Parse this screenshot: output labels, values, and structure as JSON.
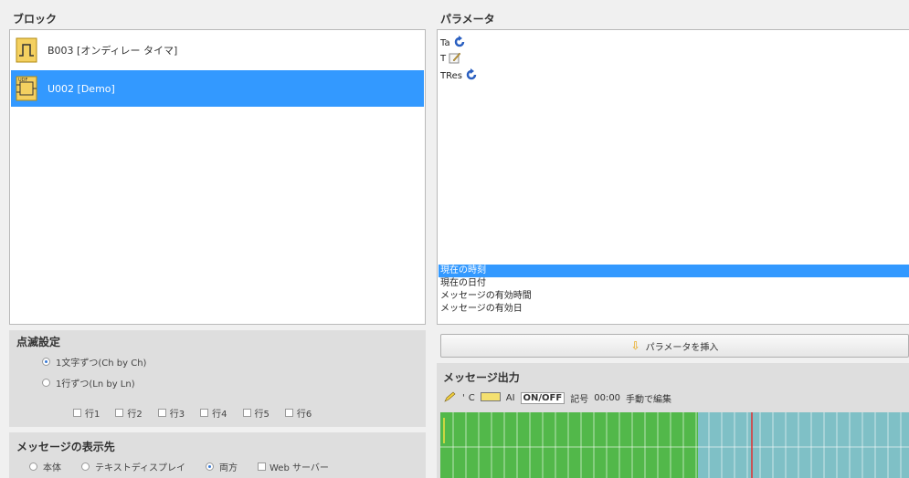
{
  "blocks": {
    "title": "ブロック",
    "items": [
      {
        "label": "B003 [オンディレー タイマ]",
        "selected": false
      },
      {
        "label": "U002 [Demo]",
        "selected": true
      }
    ]
  },
  "parameters": {
    "title": "パラメータ",
    "items": [
      "Ta",
      "T",
      "TRes"
    ],
    "options": [
      "現在の時刻",
      "現在の日付",
      "メッセージの有効時間",
      "メッセージの有効日"
    ],
    "selected_option": "現在の時刻"
  },
  "blink": {
    "title": "点滅設定",
    "modes": [
      {
        "label": "1文字ずつ(Ch by Ch)",
        "checked": true
      },
      {
        "label": "1行ずつ(Ln by Ln)",
        "checked": false
      }
    ],
    "rows": [
      "行1",
      "行2",
      "行3",
      "行4",
      "行5",
      "行6"
    ]
  },
  "destination": {
    "title": "メッセージの表示先",
    "options": [
      {
        "label": "本体",
        "type": "radio",
        "checked": false
      },
      {
        "label": "テキストディスプレイ",
        "type": "radio",
        "checked": false
      },
      {
        "label": "両方",
        "type": "radio",
        "checked": true
      },
      {
        "label": "Web サーバー",
        "type": "checkbox",
        "checked": false
      }
    ]
  },
  "insert_button": {
    "label": "パラメータを挿入"
  },
  "output": {
    "title": "メッセージ出力",
    "toolbar": {
      "c": "C",
      "ai": "AI",
      "onoff": "ON/OFF",
      "symbol": "記号",
      "time": "00:00",
      "manual": "手動で編集"
    },
    "colors": {
      "green": "#52b84a",
      "teal": "#7fc0c6",
      "cursor": "#e03030",
      "grid": "#ffffff"
    },
    "green_fraction": 0.55
  }
}
